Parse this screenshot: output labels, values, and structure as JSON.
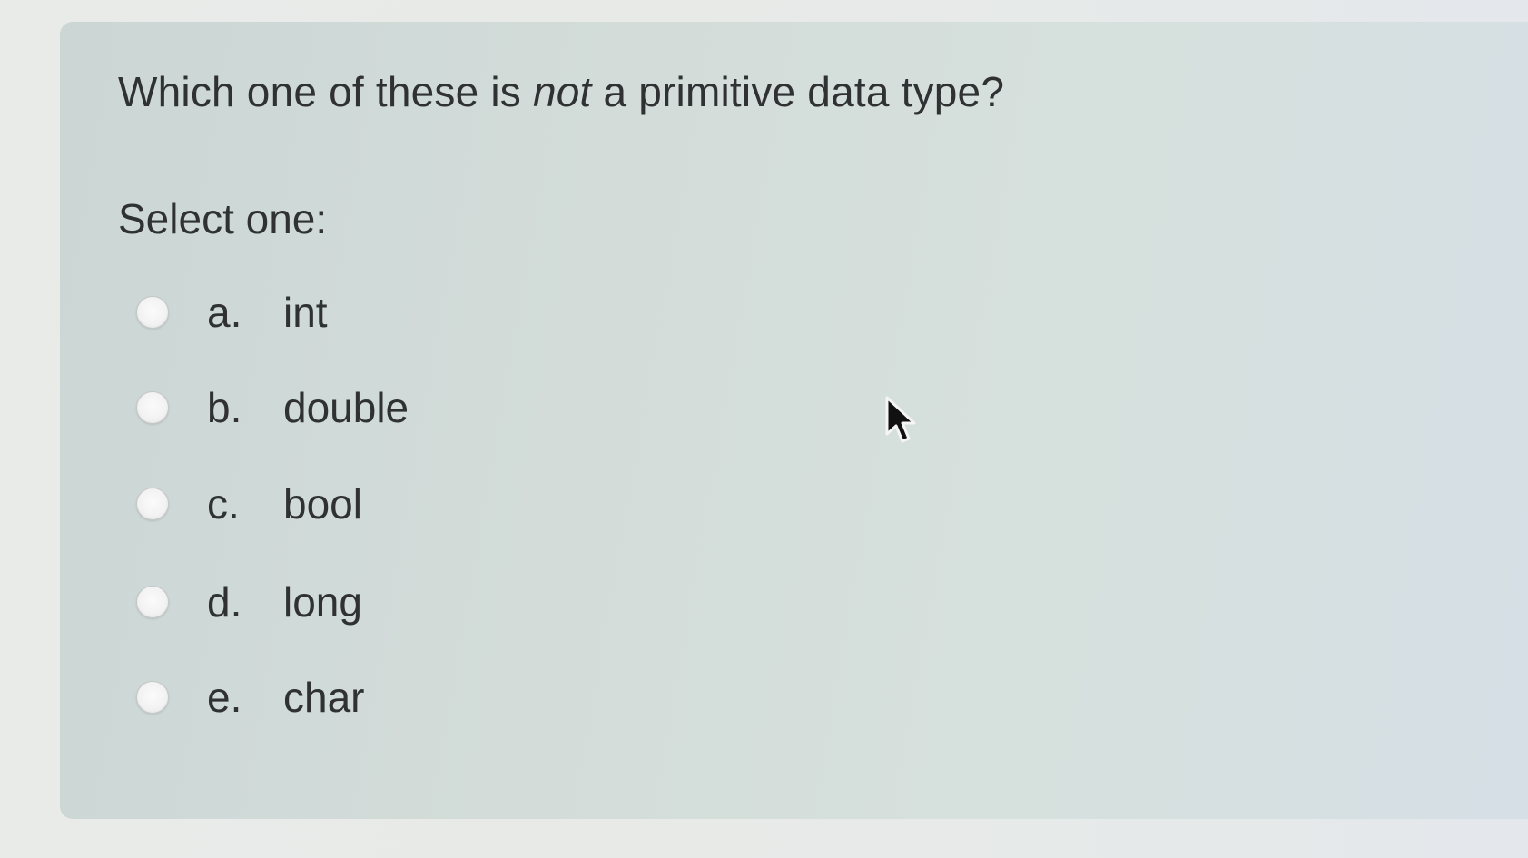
{
  "question": {
    "before": "Which one of these is ",
    "emphasis": "not",
    "after": " a primitive data type?"
  },
  "prompt": "Select one:",
  "options": [
    {
      "letter": "a.",
      "text": "int"
    },
    {
      "letter": "b.",
      "text": "double"
    },
    {
      "letter": "c.",
      "text": "bool"
    },
    {
      "letter": "d.",
      "text": "long"
    },
    {
      "letter": "e.",
      "text": "char"
    }
  ],
  "colors": {
    "panel": "#d3dcd9",
    "text": "#2f3133",
    "radio": "#f1f2f1"
  },
  "icons": {
    "radio": "radio-circle",
    "pointer": "mouse-pointer-icon"
  }
}
